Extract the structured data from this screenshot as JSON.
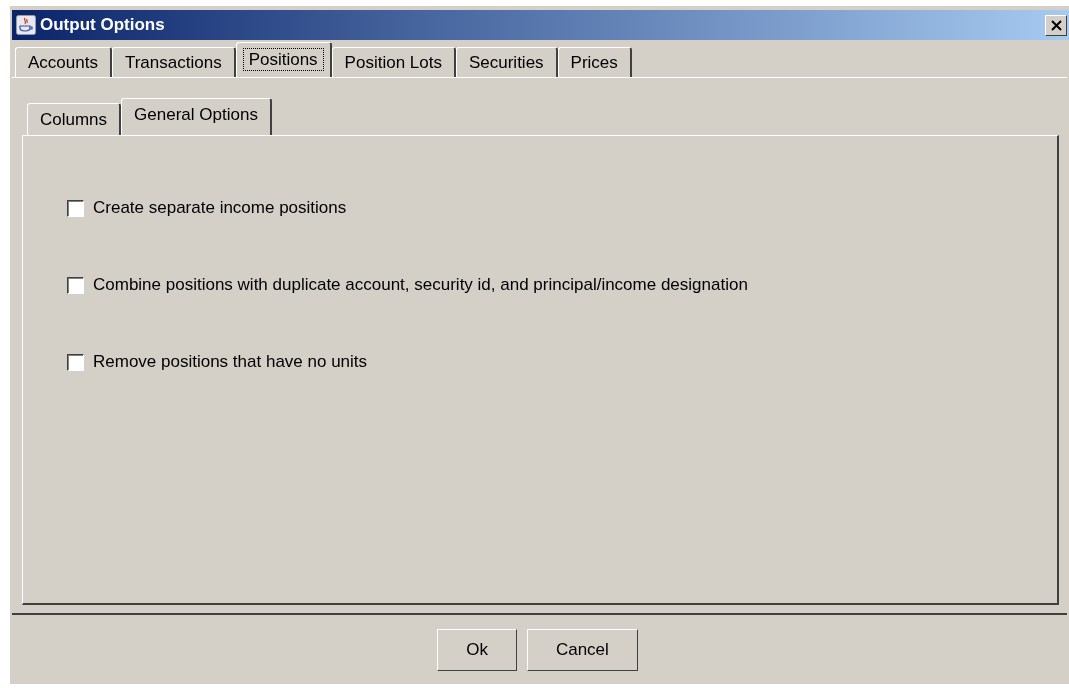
{
  "window": {
    "title": "Output Options"
  },
  "tabs": [
    {
      "label": "Accounts",
      "selected": false
    },
    {
      "label": "Transactions",
      "selected": false
    },
    {
      "label": "Positions",
      "selected": true
    },
    {
      "label": "Position Lots",
      "selected": false
    },
    {
      "label": "Securities",
      "selected": false
    },
    {
      "label": "Prices",
      "selected": false
    }
  ],
  "subtabs": [
    {
      "label": "Columns",
      "selected": false
    },
    {
      "label": "General Options",
      "selected": true
    }
  ],
  "options": [
    {
      "label": "Create separate income positions",
      "checked": false
    },
    {
      "label": "Combine positions with duplicate account, security id, and principal/income designation",
      "checked": false
    },
    {
      "label": "Remove positions that have no units",
      "checked": false
    }
  ],
  "buttons": [
    "Ok",
    "Cancel"
  ]
}
